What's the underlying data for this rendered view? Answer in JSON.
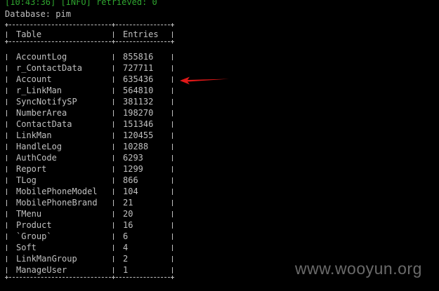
{
  "terminal": {
    "log_line": "[10:43:36] [INFO] retrieved: 0",
    "database_line": "Database: pim",
    "columns": [
      "Table",
      "Entries"
    ],
    "rows": [
      {
        "table": "AccountLog",
        "entries": "855816"
      },
      {
        "table": "r_ContactData",
        "entries": "727711"
      },
      {
        "table": "Account",
        "entries": "635436"
      },
      {
        "table": "r_LinkMan",
        "entries": "564810"
      },
      {
        "table": "SyncNotifySP",
        "entries": "381132"
      },
      {
        "table": "NumberArea",
        "entries": "198270"
      },
      {
        "table": "ContactData",
        "entries": "151346"
      },
      {
        "table": "LinkMan",
        "entries": "120455"
      },
      {
        "table": "HandleLog",
        "entries": "10288"
      },
      {
        "table": "AuthCode",
        "entries": "6293"
      },
      {
        "table": "Report",
        "entries": "1299"
      },
      {
        "table": "TLog",
        "entries": "866"
      },
      {
        "table": "MobilePhoneModel",
        "entries": "104"
      },
      {
        "table": "MobilePhoneBrand",
        "entries": "21"
      },
      {
        "table": "TMenu",
        "entries": "20"
      },
      {
        "table": "Product",
        "entries": "16"
      },
      {
        "table": "`Group`",
        "entries": "6"
      },
      {
        "table": "Soft",
        "entries": "4"
      },
      {
        "table": "LinkManGroup",
        "entries": "2"
      },
      {
        "table": "ManageUser",
        "entries": "1"
      }
    ]
  },
  "annotation": {
    "arrow_color": "#e01818",
    "arrow_icon": "red-arrow-left-icon"
  },
  "watermark": {
    "text": "www.wooyun.org"
  },
  "colors": {
    "background": "#000000",
    "text": "#c0c0c0",
    "log_green": "#2fa52f"
  }
}
